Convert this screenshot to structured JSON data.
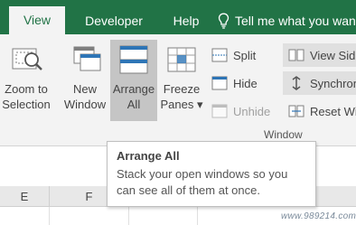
{
  "tabs": [
    {
      "label": "View"
    },
    {
      "label": "Developer"
    },
    {
      "label": "Help"
    }
  ],
  "tell_me": "Tell me what you wan",
  "ribbon": {
    "zoom_to_selection": {
      "line1": "Zoom to",
      "line2": "Selection"
    },
    "new_window": {
      "line1": "New",
      "line2": "Window"
    },
    "arrange_all": {
      "line1": "Arrange",
      "line2": "All"
    },
    "freeze_panes": {
      "line1": "Freeze",
      "line2": "Panes ▾"
    },
    "split": "Split",
    "hide": "Hide",
    "unhide": "Unhide",
    "view_side_by_side": "View Sid",
    "synchronous": "Synchrono",
    "reset_window": "Reset Wi",
    "group_label": "Window"
  },
  "tooltip": {
    "title": "Arrange All",
    "body": "Stack your open windows so you can see all of them at once."
  },
  "columns": [
    "E",
    "F"
  ],
  "watermark": "www.989214.com",
  "colors": {
    "excel_green": "#217346",
    "ribbon_bg": "#f3f3f3",
    "hover": "#c5c5c5"
  }
}
